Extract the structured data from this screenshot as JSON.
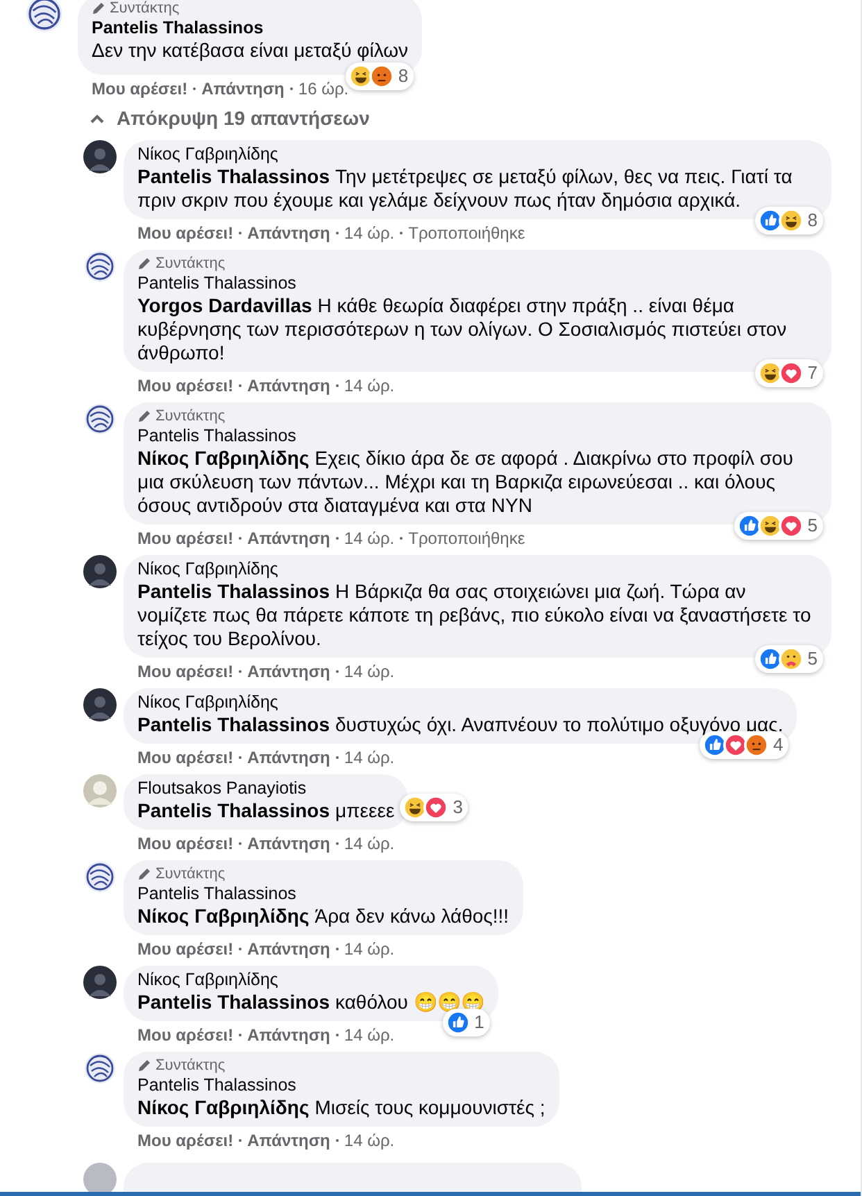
{
  "top_comment": {
    "avatar": {
      "kind": "logo"
    },
    "badge": "Συντάκτης",
    "name": "Pantelis Thalassinos",
    "text": "Δεν την κατέβασα είναι μεταξύ φίλων",
    "actions": {
      "like": "Μου αρέσει!",
      "reply": "Απάντηση",
      "time": "16 ώρ."
    },
    "reactions": {
      "kind": "corner",
      "icons": [
        {
          "kind": "haha"
        },
        {
          "kind": "angry"
        }
      ],
      "count": "8"
    }
  },
  "toggle": {
    "label": "Απόκρυψη 19 απαντήσεων",
    "expanded": true
  },
  "replies": [
    {
      "avatar": {
        "kind": "dark"
      },
      "name": "Νίκος Γαβριηλίδης",
      "mention": "Pantelis Thalassinos",
      "text": "Την μετέτρεψες σε μεταξύ φίλων, θες να πεις. Γιατί τα πριν σκριν που έχουμε και γελάμε δείχνουν πως ήταν δημόσια αρχικά.",
      "actions": {
        "like": "Μου αρέσει!",
        "reply": "Απάντηση",
        "time": "14 ώρ.",
        "edited": "Τροποποιήθηκε"
      },
      "reactions": {
        "kind": "corner",
        "icons": [
          {
            "kind": "like"
          },
          {
            "kind": "haha"
          }
        ],
        "count": "8"
      }
    },
    {
      "avatar": {
        "kind": "logo"
      },
      "badge": "Συντάκτης",
      "name": "Pantelis Thalassinos",
      "mention": "Yorgos Dardavillas",
      "text": "Η κάθε θεωρία διαφέρει στην πράξη .. είναι θέμα κυβέρνησης των περισσότερων η των ολίγων. Ο Σοσιαλισμός πιστεύει στον άνθρωπο!",
      "actions": {
        "like": "Μου αρέσει!",
        "reply": "Απάντηση",
        "time": "14 ώρ."
      },
      "reactions": {
        "kind": "corner",
        "icons": [
          {
            "kind": "haha"
          },
          {
            "kind": "love"
          }
        ],
        "count": "7"
      }
    },
    {
      "avatar": {
        "kind": "logo"
      },
      "badge": "Συντάκτης",
      "name": "Pantelis Thalassinos",
      "mention": "Νίκος Γαβριηλίδης",
      "text": "Εχεις δίκιο άρα δε σε αφορά . Διακρίνω στο προφίλ σου μια σκύλευση των πάντων... Μέχρι και τη Βαρκιζα ειρωνεύεσαι .. και όλους όσους αντιδρούν στα διαταγμένα και στα ΝΥΝ",
      "actions": {
        "like": "Μου αρέσει!",
        "reply": "Απάντηση",
        "time": "14 ώρ.",
        "edited": "Τροποποιήθηκε"
      },
      "reactions": {
        "kind": "corner",
        "icons": [
          {
            "kind": "like"
          },
          {
            "kind": "haha"
          },
          {
            "kind": "love"
          }
        ],
        "count": "5"
      }
    },
    {
      "avatar": {
        "kind": "dark"
      },
      "name": "Νίκος Γαβριηλίδης",
      "mention": "Pantelis Thalassinos",
      "text": "Η Βάρκιζα θα σας στοιχειώνει μια ζωή. Τώρα αν νομίζετε πως θα πάρετε κάποτε τη ρεβάνς, πιο εύκολο είναι να ξαναστήσετε το τείχος του Βερολίνου.",
      "actions": {
        "like": "Μου αρέσει!",
        "reply": "Απάντηση",
        "time": "14 ώρ."
      },
      "reactions": {
        "kind": "corner",
        "icons": [
          {
            "kind": "like"
          },
          {
            "kind": "care"
          }
        ],
        "count": "5"
      }
    },
    {
      "avatar": {
        "kind": "dark"
      },
      "name": "Νίκος Γαβριηλίδης",
      "mention": "Pantelis Thalassinos",
      "text": "δυστυχώς όχι. Αναπνέουν το πολύτιμο οξυγόνο μας.",
      "actions": {
        "like": "Μου αρέσει!",
        "reply": "Απάντηση",
        "time": "14 ώρ."
      },
      "reactions": {
        "kind": "corner",
        "icons": [
          {
            "kind": "like"
          },
          {
            "kind": "love"
          },
          {
            "kind": "angry"
          }
        ],
        "count": "4"
      }
    },
    {
      "avatar": {
        "kind": "light"
      },
      "name": "Floutsakos Panayiotis",
      "mention": "Pantelis Thalassinos",
      "text": "μπεεεε",
      "actions": {
        "like": "Μου αρέσει!",
        "reply": "Απάντηση",
        "time": "14 ώρ."
      },
      "reactions": {
        "kind": "side",
        "icons": [
          {
            "kind": "haha"
          },
          {
            "kind": "love"
          }
        ],
        "count": "3"
      }
    },
    {
      "avatar": {
        "kind": "logo"
      },
      "badge": "Συντάκτης",
      "name": "Pantelis Thalassinos",
      "mention": "Νίκος Γαβριηλίδης",
      "text": "Άρα δεν κάνω λάθος!!!",
      "actions": {
        "like": "Μου αρέσει!",
        "reply": "Απάντηση",
        "time": "14 ώρ."
      }
    },
    {
      "avatar": {
        "kind": "dark"
      },
      "name": "Νίκος Γαβριηλίδης",
      "mention": "Pantelis Thalassinos",
      "text": "καθόλου 😁😁😁",
      "actions": {
        "like": "Μου αρέσει!",
        "reply": "Απάντηση",
        "time": "14 ώρ."
      },
      "reactions": {
        "kind": "corner",
        "icons": [
          {
            "kind": "like"
          }
        ],
        "count": "1"
      }
    },
    {
      "avatar": {
        "kind": "logo"
      },
      "badge": "Συντάκτης",
      "name": "Pantelis Thalassinos",
      "mention": "Νίκος Γαβριηλίδης",
      "text": "Μισείς τους κομμουνιστές ;",
      "actions": {
        "like": "Μου αρέσει!",
        "reply": "Απάντηση",
        "time": "14 ώρ."
      }
    }
  ]
}
